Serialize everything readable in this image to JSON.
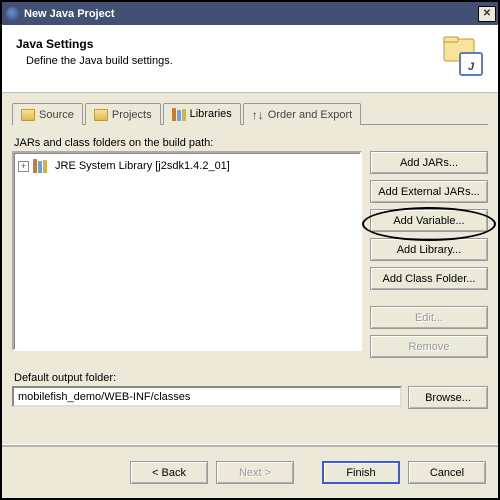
{
  "window": {
    "title": "New Java Project"
  },
  "header": {
    "title": "Java Settings",
    "subtitle": "Define the Java build settings."
  },
  "tabs": {
    "source": "Source",
    "projects": "Projects",
    "libraries": "Libraries",
    "order_export": "Order and Export"
  },
  "buildpath": {
    "label": "JARs and class folders on the build path:",
    "tree_item0": "JRE System Library [j2sdk1.4.2_01]"
  },
  "buttons": {
    "add_jars": "Add JARs...",
    "add_ext_jars": "Add External JARs...",
    "add_variable": "Add Variable...",
    "add_library": "Add Library...",
    "add_class_folder": "Add Class Folder...",
    "edit": "Edit...",
    "remove": "Remove"
  },
  "output": {
    "label": "Default output folder:",
    "value": "mobilefish_demo/WEB-INF/classes",
    "browse": "Browse..."
  },
  "wizard": {
    "back": "< Back",
    "next": "Next >",
    "finish": "Finish",
    "cancel": "Cancel"
  }
}
